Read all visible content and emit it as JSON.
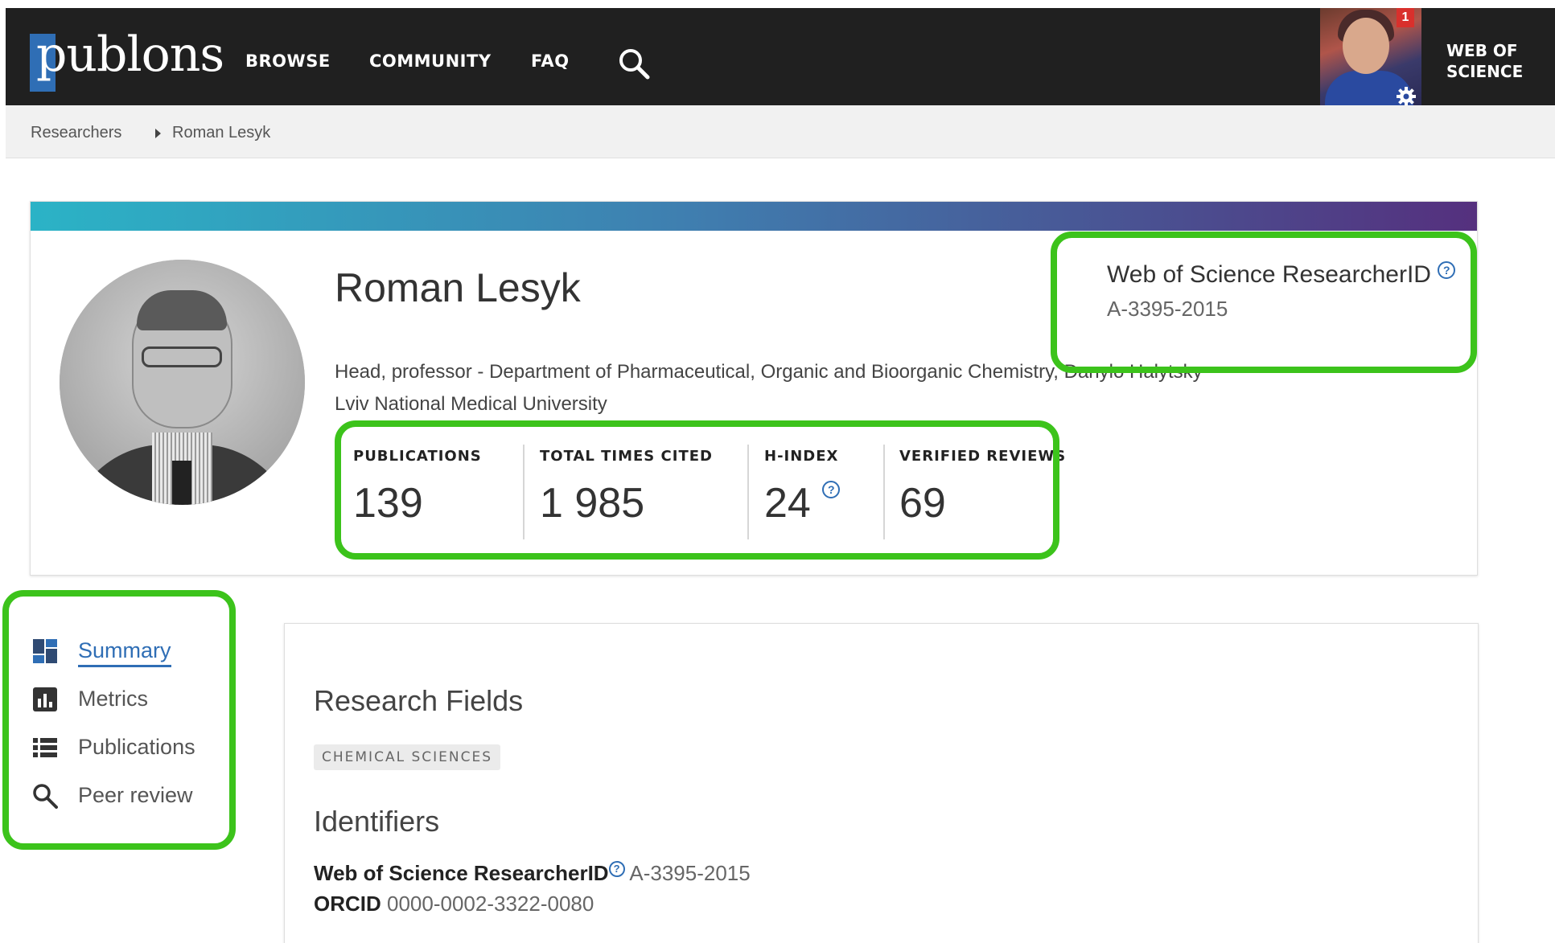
{
  "header": {
    "logo": "publons",
    "nav": [
      "BROWSE",
      "COMMUNITY",
      "FAQ"
    ],
    "notification_count": "1",
    "wos_line1": "WEB OF",
    "wos_line2": "SCIENCE"
  },
  "breadcrumb": {
    "parent": "Researchers",
    "current": "Roman Lesyk"
  },
  "profile": {
    "name": "Roman Lesyk",
    "affiliation_line1": "Head, professor - Department of Pharmaceutical, Organic and Bioorganic Chemistry, Danylo Halytsky",
    "affiliation_line2": "Lviv National Medical University",
    "researcher_id_label": "Web of Science ResearcherID",
    "researcher_id": "A-3395-2015"
  },
  "stats": [
    {
      "label": "PUBLICATIONS",
      "value": "139"
    },
    {
      "label": "TOTAL TIMES CITED",
      "value": "1 985"
    },
    {
      "label": "H-INDEX",
      "value": "24"
    },
    {
      "label": "VERIFIED REVIEWS",
      "value": "69"
    }
  ],
  "sidebar": {
    "items": [
      {
        "label": "Summary",
        "icon": "dashboard-icon",
        "active": true
      },
      {
        "label": "Metrics",
        "icon": "bar-chart-icon"
      },
      {
        "label": "Publications",
        "icon": "list-icon"
      },
      {
        "label": "Peer review",
        "icon": "search-icon"
      }
    ]
  },
  "content": {
    "research_fields_title": "Research Fields",
    "field_tag": "CHEMICAL SCIENCES",
    "identifiers_title": "Identifiers",
    "wos_id_label": "Web of Science ResearcherID",
    "wos_id_value": "A-3395-2015",
    "orcid_label": "ORCID",
    "orcid_value": "0000-0002-3322-0080"
  },
  "colors": {
    "highlight": "#3cc31b",
    "accent": "#2f6eb5",
    "topbar": "#202020"
  }
}
